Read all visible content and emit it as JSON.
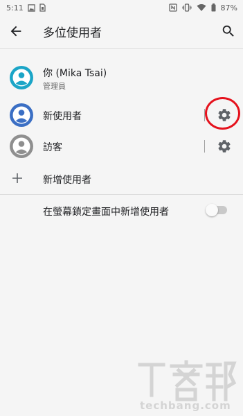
{
  "status_bar": {
    "time": "5:11",
    "battery": "87%",
    "icons": [
      "image-notification-icon",
      "sim-notification-icon",
      "nfc-icon",
      "vibrate-icon",
      "wifi-icon",
      "battery-icon"
    ]
  },
  "app_bar": {
    "title": "多位使用者",
    "back_icon": "arrow-left-icon",
    "search_icon": "search-icon"
  },
  "users": [
    {
      "name": "你 (Mika Tsai)",
      "role": "管理員",
      "avatar_color": "#1ba5c7"
    },
    {
      "name": "新使用者",
      "avatar_color": "#3b6fc4",
      "settings_icon": "gear-icon",
      "highlighted": true
    },
    {
      "name": "訪客",
      "avatar_color": "#8f8f8f",
      "settings_icon": "gear-icon"
    }
  ],
  "add_user": {
    "label": "新增使用者",
    "icon": "plus-icon"
  },
  "lockscreen_setting": {
    "label": "在螢幕鎖定畫面中新增使用者",
    "enabled": false
  },
  "watermark": {
    "logo_text": "T客邦",
    "domain": "techbang.com"
  },
  "colors": {
    "background": "#f5f5f5",
    "highlight_ring": "#e5121d",
    "icon_gray": "#5f6368"
  }
}
